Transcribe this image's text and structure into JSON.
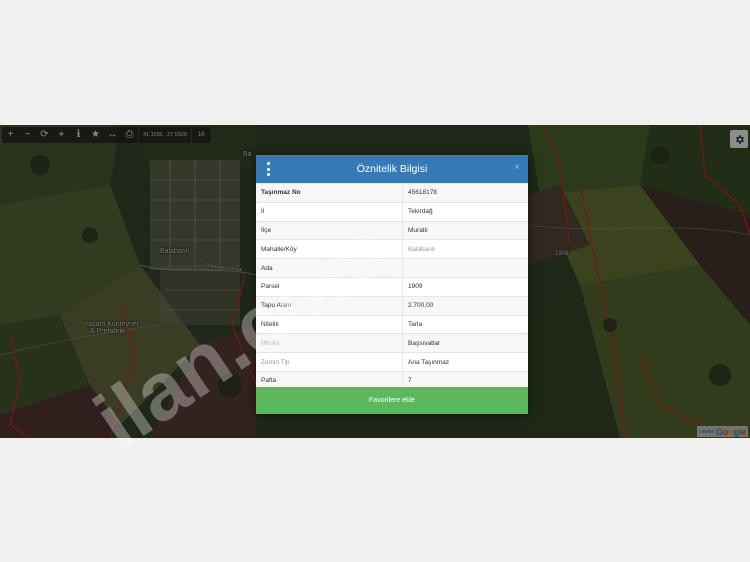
{
  "map": {
    "toolbar": {
      "buttons": [
        {
          "name": "zoom-in-button",
          "glyph": "+"
        },
        {
          "name": "zoom-out-button",
          "glyph": "−"
        },
        {
          "name": "refresh-button",
          "glyph": "⟳"
        },
        {
          "name": "locate-button",
          "glyph": "⌖"
        },
        {
          "name": "info-button",
          "glyph": "ℹ"
        },
        {
          "name": "favorite-button",
          "glyph": "★"
        },
        {
          "name": "measure-button",
          "glyph": "↔"
        },
        {
          "name": "print-button",
          "glyph": "⎙"
        }
      ],
      "coordinates": "41.1155 , 27.5926",
      "zoom_level": "16"
    },
    "labels": {
      "village": "Balabanlı",
      "road": "Balabanlı Kavak",
      "poi_line1": "Yaşam Konteyner",
      "poi_line2": "& Prefabrik",
      "top_partial": "Ba",
      "right_marker": "1909"
    },
    "attribution": {
      "leaflet": "Leaflet",
      "google": "Google"
    }
  },
  "modal": {
    "title": "Öznitelik Bilgisi",
    "close_glyph": "×",
    "rows": [
      {
        "key": "Taşınmaz No",
        "value": "45618178"
      },
      {
        "key": "İl",
        "value": "Tekirdağ"
      },
      {
        "key": "İlçe",
        "value": "Muratlı"
      },
      {
        "key": "Mahalle/Köy",
        "value": "Balabanlı"
      },
      {
        "key": "Ada",
        "value": ""
      },
      {
        "key": "Parsel",
        "value": "1909"
      },
      {
        "key": "Tapu Alanı",
        "value": "2.700,00"
      },
      {
        "key": "Nitelik",
        "value": "Tarla"
      },
      {
        "key": "Mevkii",
        "value": "Başsıvatlar"
      },
      {
        "key": "Zemin Tip",
        "value": "Ana Taşınmaz"
      },
      {
        "key": "Pafta",
        "value": "7"
      }
    ],
    "favorite_button": "Favorilere ekle"
  },
  "watermark": {
    "text": "ilan.com"
  },
  "colors": {
    "header_blue": "#337ab7",
    "button_green": "#5cb85c",
    "parcel_red": "#e0292a"
  }
}
